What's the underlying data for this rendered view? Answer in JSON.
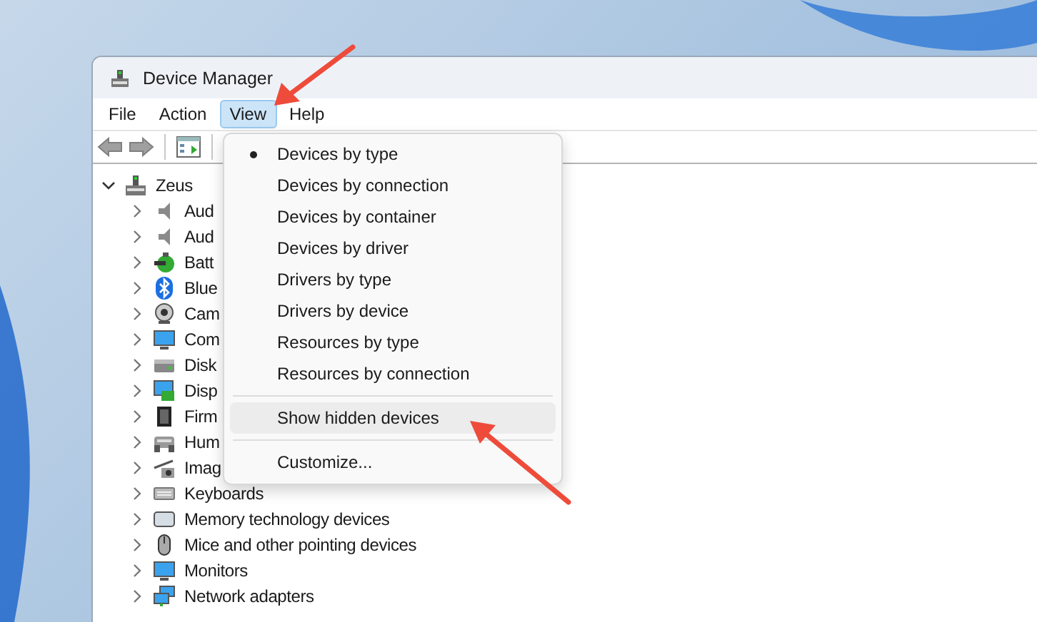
{
  "window": {
    "title": "Device Manager"
  },
  "menu_bar": [
    {
      "label": "File",
      "selected": false
    },
    {
      "label": "Action",
      "selected": false
    },
    {
      "label": "View",
      "selected": true
    },
    {
      "label": "Help",
      "selected": false
    }
  ],
  "toolbar": [
    {
      "kind": "back",
      "disabled": true
    },
    {
      "kind": "forward",
      "disabled": true
    },
    {
      "kind": "separator"
    },
    {
      "kind": "properties",
      "disabled": false
    },
    {
      "kind": "separator"
    }
  ],
  "tree": {
    "label": "Zeus",
    "expanded": true,
    "children": [
      {
        "label": "Aud",
        "expanded": false
      },
      {
        "label": "Aud",
        "expanded": false
      },
      {
        "label": "Batt",
        "expanded": false
      },
      {
        "label": "Blue",
        "expanded": false
      },
      {
        "label": "Cam",
        "expanded": false
      },
      {
        "label": "Com",
        "expanded": false
      },
      {
        "label": "Disk",
        "expanded": false
      },
      {
        "label": "Disp",
        "expanded": false
      },
      {
        "label": "Firm",
        "expanded": false
      },
      {
        "label": "Hum",
        "expanded": false
      },
      {
        "label": "Imag",
        "expanded": false
      },
      {
        "label": "Keyboards",
        "expanded": false
      },
      {
        "label": "Memory technology devices",
        "expanded": false
      },
      {
        "label": "Mice and other pointing devices",
        "expanded": false
      },
      {
        "label": "Monitors",
        "expanded": false
      },
      {
        "label": "Network adapters",
        "expanded": false
      }
    ]
  },
  "view_menu": [
    [
      {
        "label": "Devices by type",
        "selected": true,
        "highlighted": false
      },
      {
        "label": "Devices by connection",
        "selected": false,
        "highlighted": false
      },
      {
        "label": "Devices by container",
        "selected": false,
        "highlighted": false
      },
      {
        "label": "Devices by driver",
        "selected": false,
        "highlighted": false
      },
      {
        "label": "Drivers by type",
        "selected": false,
        "highlighted": false
      },
      {
        "label": "Drivers by device",
        "selected": false,
        "highlighted": false
      },
      {
        "label": "Resources by type",
        "selected": false,
        "highlighted": false
      },
      {
        "label": "Resources by connection",
        "selected": false,
        "highlighted": false
      }
    ],
    [
      {
        "label": "Show hidden devices",
        "selected": false,
        "highlighted": true
      }
    ],
    [
      {
        "label": "Customize...",
        "selected": false,
        "highlighted": false
      }
    ]
  ]
}
